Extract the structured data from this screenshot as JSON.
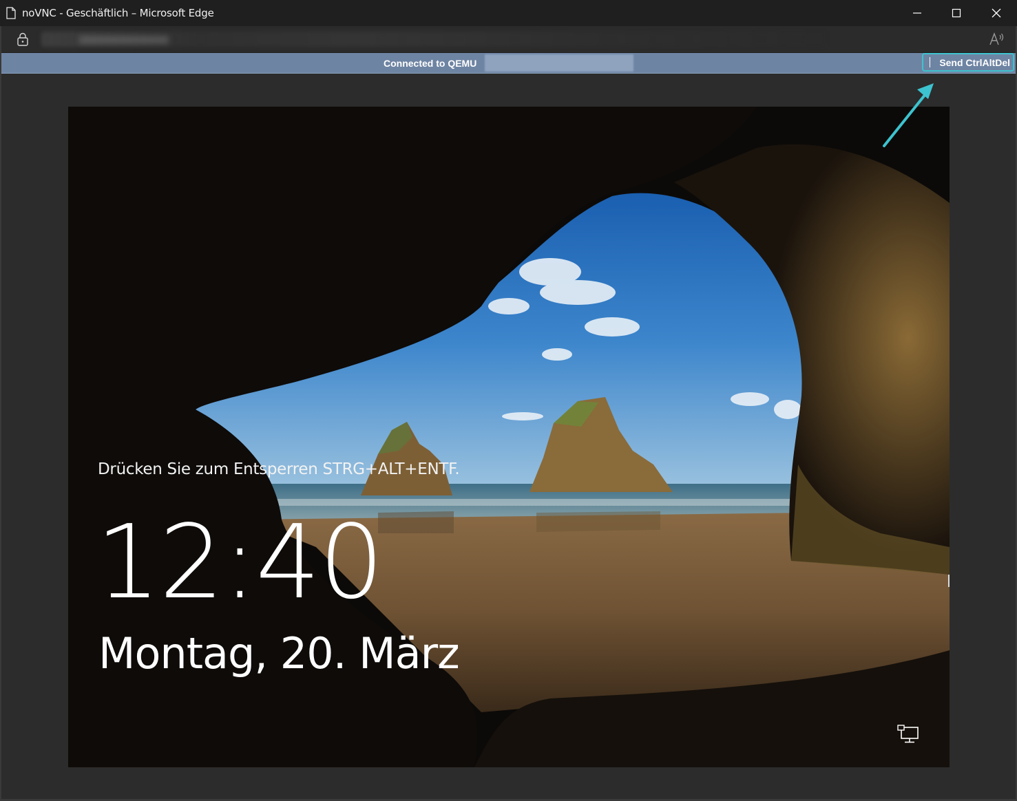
{
  "window": {
    "title": "noVNC - Geschäftlich – Microsoft Edge",
    "minimize_icon": "minimize-icon",
    "maximize_icon": "maximize-icon",
    "close_icon": "close-icon"
  },
  "addressbar": {
    "lock_icon": "lock-icon",
    "readaloud_icon": "read-aloud-icon"
  },
  "vnc": {
    "status": "Connected to QEMU",
    "send_cad_label": "Send CtrlAltDel"
  },
  "lockscreen": {
    "hint": "Drücken Sie zum Entsperren STRG+ALT+ENTF.",
    "time": "12:40",
    "date": "Montag, 20. März",
    "network_icon": "network-icon"
  },
  "colors": {
    "vnc_bar": "#6e84a3",
    "highlight": "#3dc3cf",
    "titlebar": "#1f1f1f"
  }
}
